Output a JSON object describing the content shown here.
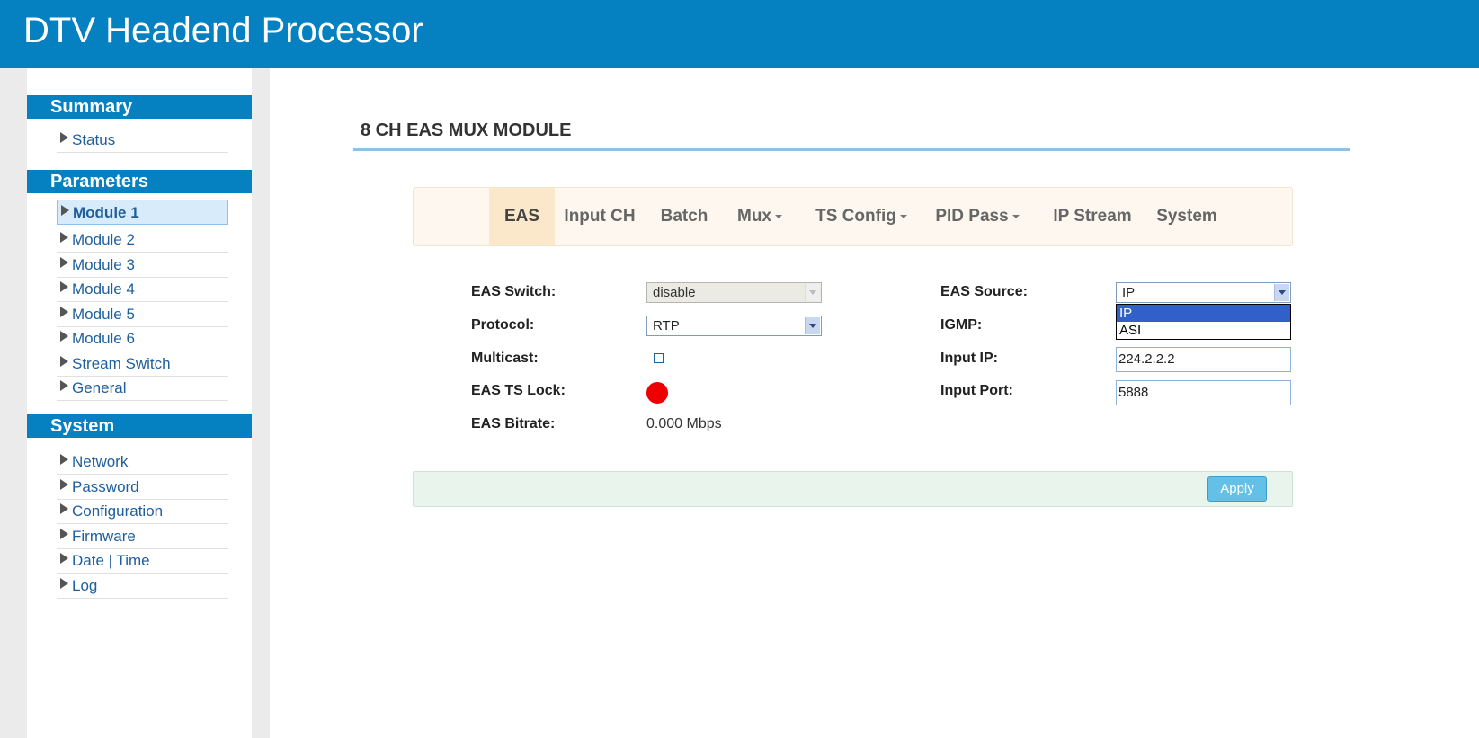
{
  "header": {
    "title": "DTV Headend Processor"
  },
  "sidebar": {
    "sections": [
      {
        "title": "Summary",
        "items": [
          {
            "label": "Status"
          }
        ]
      },
      {
        "title": "Parameters",
        "items": [
          {
            "label": "Module 1"
          },
          {
            "label": "Module 2"
          },
          {
            "label": "Module 3"
          },
          {
            "label": "Module 4"
          },
          {
            "label": "Module 5"
          },
          {
            "label": "Module 6"
          },
          {
            "label": "Stream Switch"
          },
          {
            "label": "General"
          }
        ]
      },
      {
        "title": "System",
        "items": [
          {
            "label": "Network"
          },
          {
            "label": "Password"
          },
          {
            "label": "Configuration"
          },
          {
            "label": "Firmware"
          },
          {
            "label": "Date | Time"
          },
          {
            "label": "Log"
          }
        ]
      }
    ],
    "active_item": "Module 1"
  },
  "main": {
    "page_title": "8 CH EAS MUX MODULE",
    "tabs": [
      {
        "label": "EAS",
        "active": true
      },
      {
        "label": "Input CH"
      },
      {
        "label": "Batch"
      },
      {
        "label": "Mux",
        "dropdown": true
      },
      {
        "label": "TS Config",
        "dropdown": true
      },
      {
        "label": "PID Pass",
        "dropdown": true
      },
      {
        "label": "IP Stream"
      },
      {
        "label": "System"
      }
    ],
    "form_left": {
      "eas_switch": {
        "label": "EAS Switch:",
        "value": "disable"
      },
      "protocol": {
        "label": "Protocol:",
        "value": "RTP"
      },
      "multicast": {
        "label": "Multicast:",
        "checked": false
      },
      "eas_ts_lock": {
        "label": "EAS TS Lock:",
        "status_color": "#ee0000"
      },
      "eas_bitrate": {
        "label": "EAS Bitrate:",
        "value": "0.000 Mbps"
      }
    },
    "form_right": {
      "eas_source": {
        "label": "EAS Source:",
        "value": "IP",
        "options": [
          "IP",
          "ASI"
        ],
        "highlighted": "IP"
      },
      "igmp": {
        "label": "IGMP:"
      },
      "input_ip": {
        "label": "Input IP:",
        "value": "224.2.2.2"
      },
      "input_port": {
        "label": "Input Port:",
        "value": "5888"
      }
    },
    "apply_label": "Apply"
  },
  "colors": {
    "brand": "#0580c0",
    "active_tab": "#fbe8cb",
    "apply": "#63c0e6",
    "led": "#ee0000"
  }
}
